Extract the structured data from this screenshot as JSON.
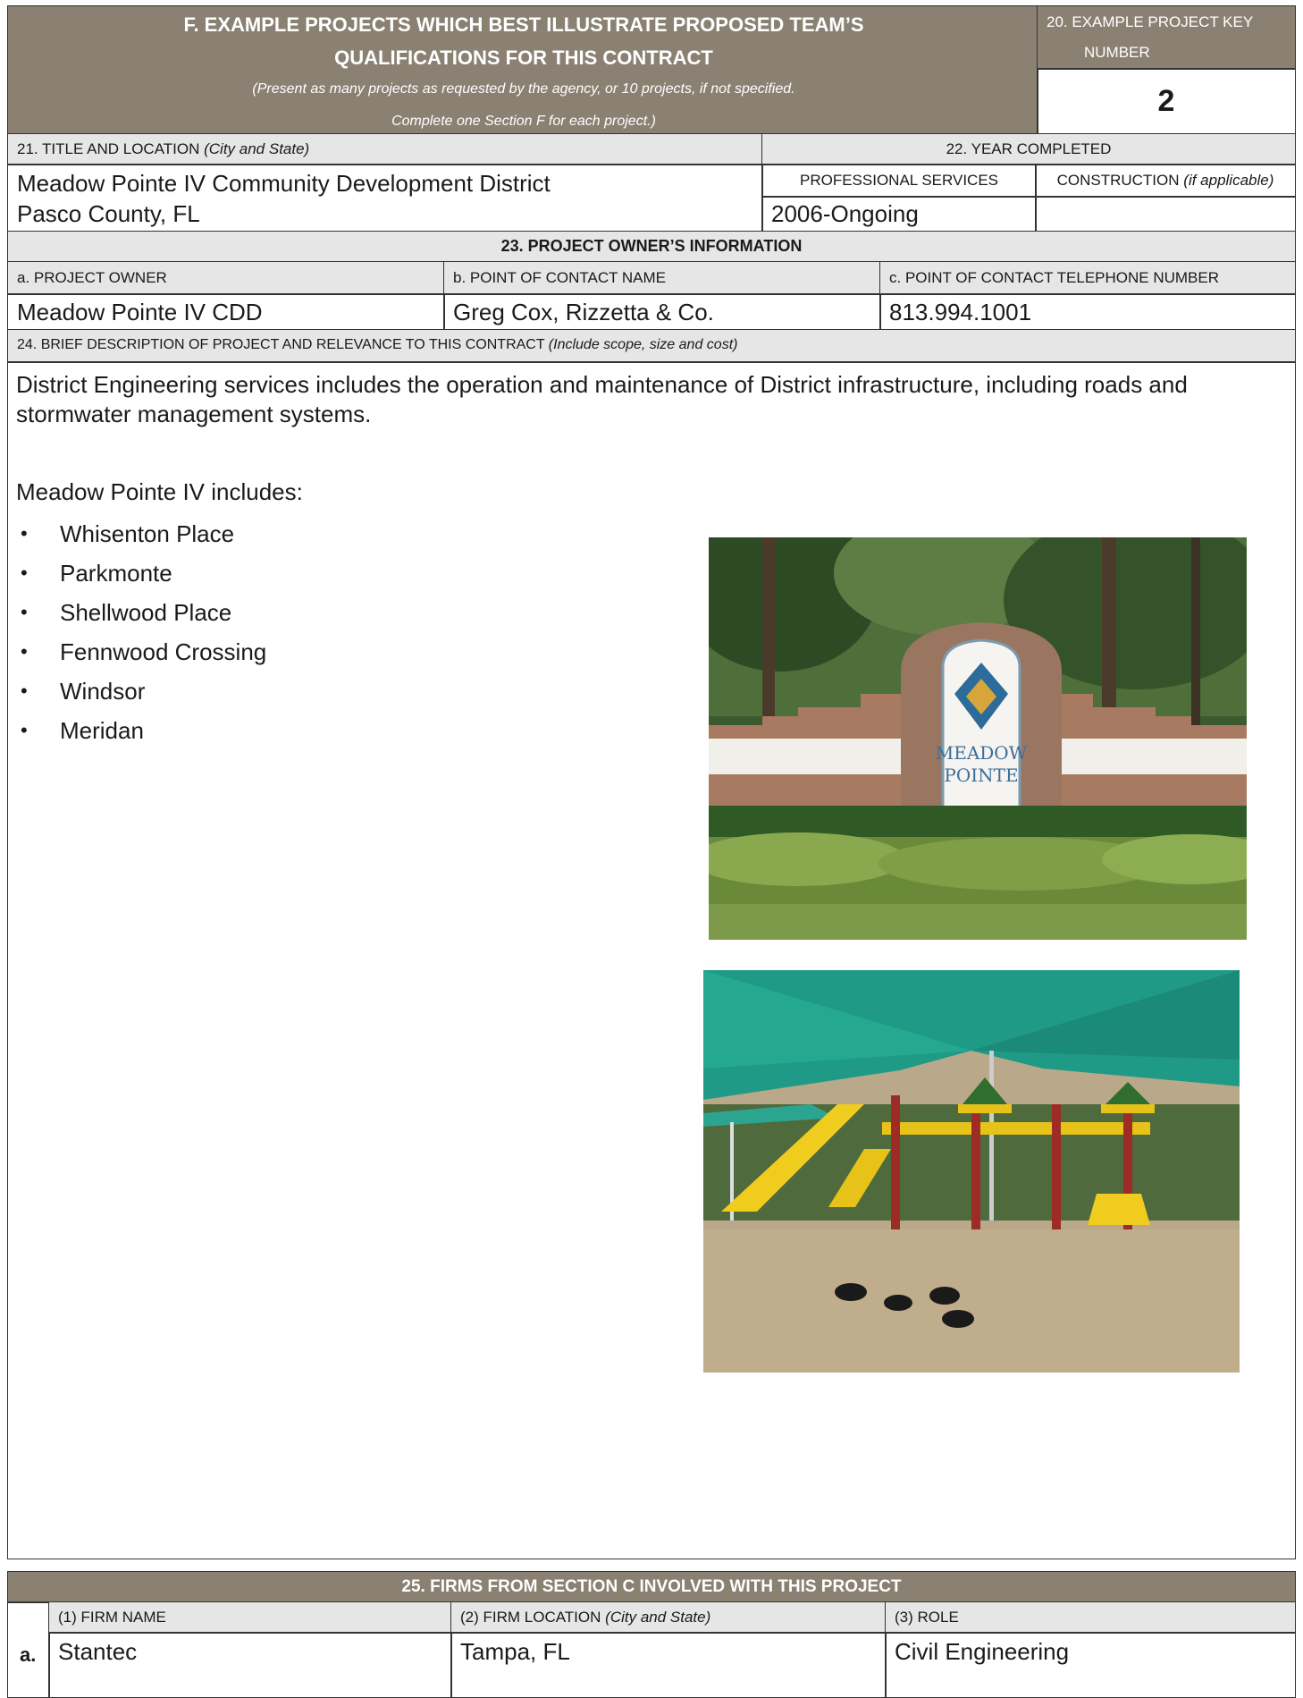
{
  "section_f": {
    "title_line1": "F. EXAMPLE PROJECTS WHICH BEST ILLUSTRATE PROPOSED TEAM’S",
    "title_line2": "QUALIFICATIONS FOR THIS CONTRACT",
    "note_line1": "(Present as many projects as requested by the agency, or 10 projects, if not specified.",
    "note_line2": "Complete one Section F for each project.)"
  },
  "key_number": {
    "label_line1": "20. EXAMPLE PROJECT KEY",
    "label_line2": "NUMBER",
    "value": "2"
  },
  "title_location": {
    "label": "21. TITLE AND LOCATION",
    "label_italic": "(City and State)",
    "line1": "Meadow Pointe IV Community Development District",
    "line2": "Pasco County, FL"
  },
  "year_completed": {
    "label": "22. YEAR COMPLETED",
    "professional_label": "PROFESSIONAL SERVICES",
    "construction_label": "CONSTRUCTION",
    "construction_italic": "(if applicable)",
    "professional_value": "2006-Ongoing",
    "construction_value": ""
  },
  "owner_info": {
    "header": "23. PROJECT OWNER’S INFORMATION",
    "owner_label": "a. PROJECT OWNER",
    "contact_label": "b. POINT OF CONTACT NAME",
    "phone_label": "c. POINT OF CONTACT TELEPHONE NUMBER",
    "owner_value": "Meadow Pointe IV CDD",
    "contact_value": "Greg Cox, Rizzetta & Co.",
    "phone_value": "813.994.1001"
  },
  "description": {
    "label": "24. BRIEF DESCRIPTION OF PROJECT AND RELEVANCE TO THIS CONTRACT",
    "label_italic": "(Include scope, size and cost)",
    "para1_line1": "District Engineering services includes the operation and maintenance of District infrastructure, including roads and",
    "para1_line2": "stormwater management systems.",
    "para2": "Meadow Pointe IV includes:",
    "items": [
      "Whisenton Place",
      "Parkmonte",
      "Shellwood Place",
      "Fennwood Crossing",
      "Windsor",
      "Meridan"
    ],
    "sign_text_1": "MEADOW",
    "sign_text_2": "POINTE"
  },
  "firms": {
    "header": "25. FIRMS FROM SECTION C INVOLVED WITH THIS PROJECT",
    "col1": "(1) FIRM NAME",
    "col2": "(2) FIRM LOCATION",
    "col2_italic": "(City and State)",
    "col3": "(3) ROLE",
    "rows": [
      {
        "letter": "a.",
        "name": "Stantec",
        "location": "Tampa, FL",
        "role": "Civil Engineering"
      }
    ]
  },
  "colors": {
    "header_bg": "#8b8173",
    "label_bg": "#e6e6e6",
    "border": "#333333"
  }
}
